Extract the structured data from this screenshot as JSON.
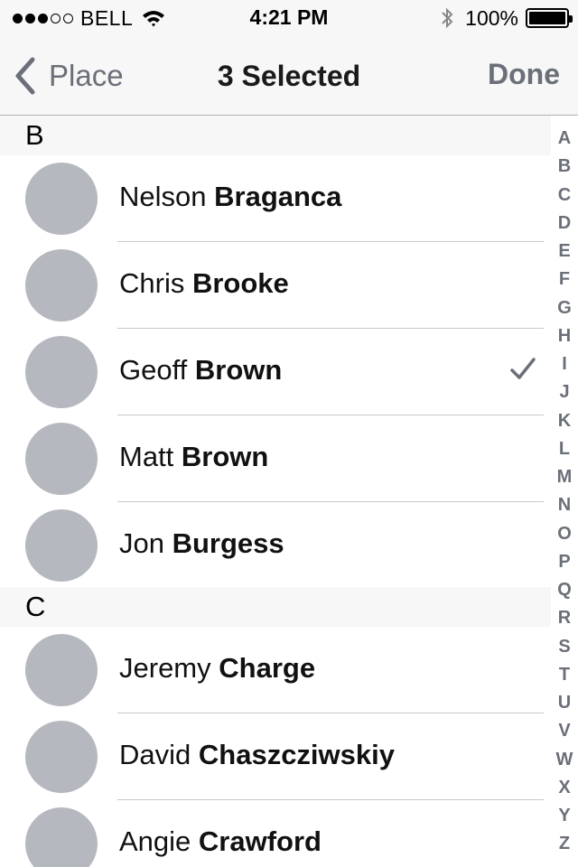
{
  "status_bar": {
    "carrier": "BELL",
    "signal_bars_filled": 3,
    "signal_bars_total": 5,
    "time": "4:21 PM",
    "battery_percent": "100%"
  },
  "nav": {
    "back_label": "Place",
    "title": "3 Selected",
    "done_label": "Done"
  },
  "sections": [
    {
      "letter": "B",
      "contacts": [
        {
          "first": "Nelson",
          "last": "Braganca",
          "selected": false
        },
        {
          "first": "Chris",
          "last": "Brooke",
          "selected": false
        },
        {
          "first": "Geoff",
          "last": "Brown",
          "selected": true
        },
        {
          "first": "Matt",
          "last": "Brown",
          "selected": false
        },
        {
          "first": "Jon",
          "last": "Burgess",
          "selected": false
        }
      ]
    },
    {
      "letter": "C",
      "contacts": [
        {
          "first": "Jeremy",
          "last": "Charge",
          "selected": false
        },
        {
          "first": "David",
          "last": "Chaszcziwskiy",
          "selected": false
        },
        {
          "first": "Angie",
          "last": "Crawford",
          "selected": false
        }
      ]
    }
  ],
  "index_letters": [
    "A",
    "B",
    "C",
    "D",
    "E",
    "F",
    "G",
    "H",
    "I",
    "J",
    "K",
    "L",
    "M",
    "N",
    "O",
    "P",
    "Q",
    "R",
    "S",
    "T",
    "U",
    "V",
    "W",
    "X",
    "Y",
    "Z"
  ],
  "colors": {
    "accent": "#6b6f78",
    "avatar": "#b6b8bf",
    "bar_background": "#f7f7f7"
  }
}
